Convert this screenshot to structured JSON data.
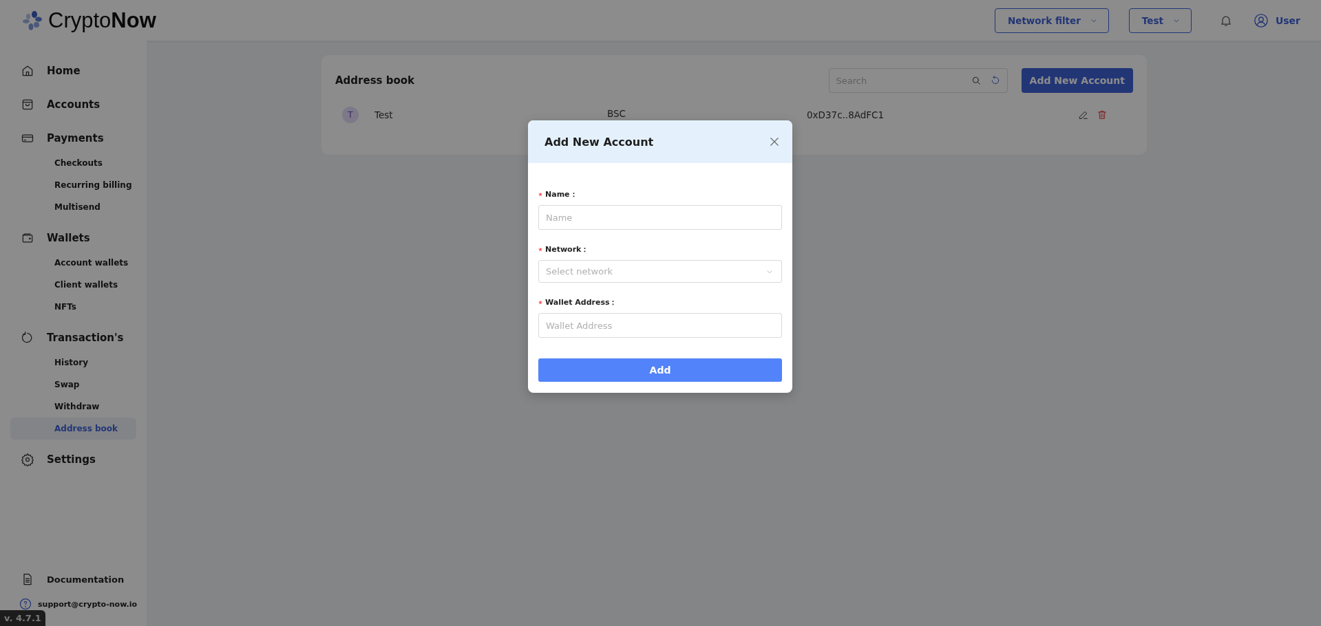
{
  "header": {
    "logo": {
      "text_light": "Crypto",
      "text_bold": "Now"
    },
    "network_filter": "Network filter",
    "account_switch": "Test",
    "user": "User"
  },
  "sidebar": {
    "items": [
      {
        "label": "Home"
      },
      {
        "label": "Accounts"
      },
      {
        "label": "Payments",
        "children": [
          {
            "label": "Checkouts",
            "selected": false
          },
          {
            "label": "Recurring billing",
            "selected": false
          },
          {
            "label": "Multisend",
            "selected": false
          }
        ]
      },
      {
        "label": "Wallets",
        "children": [
          {
            "label": "Account wallets",
            "selected": false
          },
          {
            "label": "Client wallets",
            "selected": false
          },
          {
            "label": "NFTs",
            "selected": false
          }
        ]
      },
      {
        "label": "Transaction's",
        "children": [
          {
            "label": "History",
            "selected": false
          },
          {
            "label": "Swap",
            "selected": false
          },
          {
            "label": "Withdraw",
            "selected": false
          },
          {
            "label": "Address book",
            "selected": true
          }
        ]
      },
      {
        "label": "Settings"
      }
    ],
    "footer": [
      {
        "label": "Documentation"
      },
      {
        "label": "support@crypto-now.io"
      }
    ],
    "version": "v. 4.7.1"
  },
  "address_book": {
    "title": "Address book",
    "search": {
      "placeholder": "Search"
    },
    "add_button": "Add New Account",
    "rows": [
      {
        "initial": "T",
        "name": "Test",
        "network": "BSC",
        "address": "0xD37c..8AdFC1"
      }
    ]
  },
  "modal": {
    "title": "Add New Account",
    "fields": [
      {
        "kind": "input",
        "label": "Name：",
        "required": true,
        "placeholder": "Name"
      },
      {
        "kind": "select",
        "label": "Network：",
        "required": true,
        "placeholder": "Select network"
      },
      {
        "kind": "input",
        "label": "Wallet Address：",
        "required": true,
        "placeholder": "Wallet Address"
      }
    ],
    "submit": "Add"
  }
}
